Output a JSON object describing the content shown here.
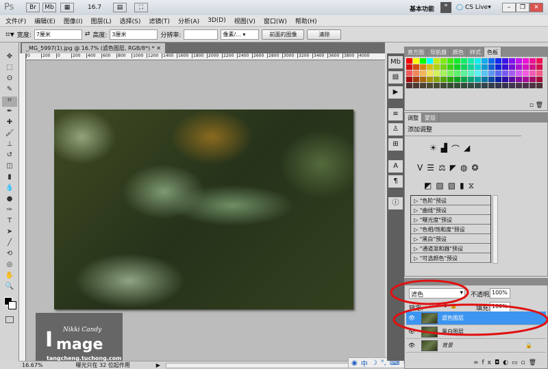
{
  "app": {
    "logo": "Ps",
    "zoom_select": "16.7",
    "workspace": "基本功能",
    "cs_live": "CS Live"
  },
  "menu": [
    "文件(F)",
    "编辑(E)",
    "图像(I)",
    "图层(L)",
    "选择(S)",
    "滤镜(T)",
    "分析(A)",
    "3D(D)",
    "视图(V)",
    "窗口(W)",
    "帮助(H)"
  ],
  "options": {
    "width_label": "宽度:",
    "width_value": "7厘米",
    "height_label": "高度:",
    "height_value": "3厘米",
    "resolution_label": "分辨率:",
    "resolution_value": "",
    "unit": "像素/...",
    "front_image": "前面的图像",
    "clear": "清除"
  },
  "document": {
    "tab_title": "_MG_5997(1).jpg @ 16.7% (滤色图层, RGB/8*) *",
    "ruler_ticks": [
      "0",
      "200",
      "0",
      "200",
      "400",
      "600",
      "800",
      "1000",
      "1200",
      "1400",
      "1600",
      "1800",
      "2000",
      "2200",
      "2400",
      "2600",
      "2800",
      "3000",
      "3200",
      "3400",
      "3600",
      "3800",
      "4000"
    ]
  },
  "status": {
    "zoom": "16.67%",
    "message": "曝光只在 32 位起作用"
  },
  "watermark": {
    "main": "mage",
    "script": "Nikki Candy",
    "url": "tangcheng.tuchong.com"
  },
  "swatches_panel": {
    "tabs": [
      "直方图",
      "导航器",
      "颜色",
      "样式",
      "色板"
    ],
    "active": "色板"
  },
  "adjustments": {
    "tabs": [
      "调整",
      "蒙版"
    ],
    "title": "添加调整",
    "presets": [
      "\"色阶\"预设",
      "\"曲线\"预设",
      "\"曝光度\"预设",
      "\"色相/饱和度\"预设",
      "\"黑白\"预设",
      "\"通道混和器\"预设",
      "\"可选颜色\"预设"
    ]
  },
  "layers": {
    "blend_mode": "滤色",
    "opacity_label": "不透明度:",
    "opacity": "100%",
    "lock_label": "锁定:",
    "fill_label": "填充:",
    "fill": "100%",
    "items": [
      {
        "name": "滤色图层",
        "selected": true
      },
      {
        "name": "黑白图层",
        "selected": false
      },
      {
        "name": "背景",
        "selected": false,
        "locked": true
      }
    ]
  },
  "ime": {
    "label": "中"
  },
  "colors": {
    "accent": "#3c95f0",
    "annotation": "#e01010"
  }
}
